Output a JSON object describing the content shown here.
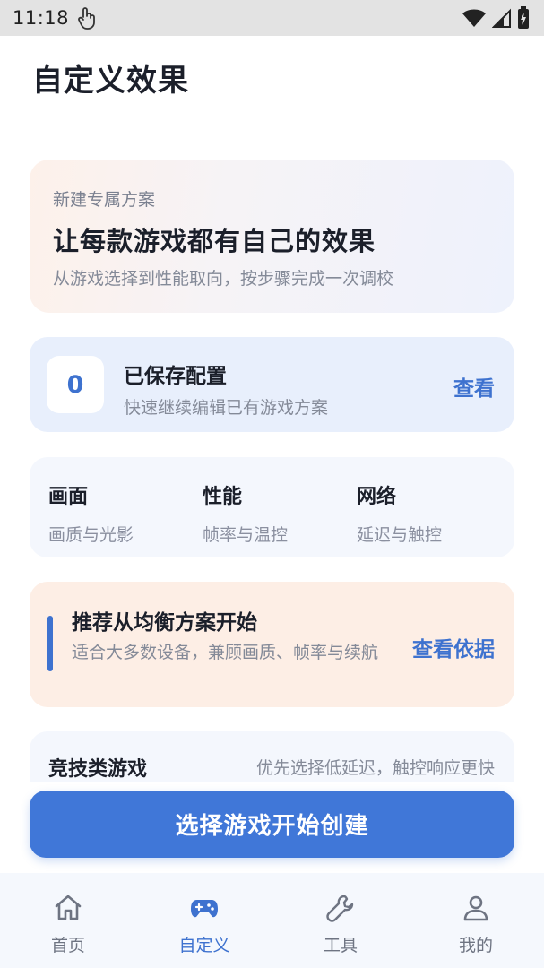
{
  "status_bar": {
    "time": "11:18"
  },
  "page": {
    "title": "自定义效果"
  },
  "hero": {
    "kicker": "新建专属方案",
    "title": "让每款游戏都有自己的效果",
    "subtitle": "从游戏选择到性能取向，按步骤完成一次调校"
  },
  "saved": {
    "count": "0",
    "title": "已保存配置",
    "subtitle": "快速继续编辑已有游戏方案",
    "link": "查看"
  },
  "categories": [
    {
      "title": "画面",
      "subtitle": "画质与光影"
    },
    {
      "title": "性能",
      "subtitle": "帧率与温控"
    },
    {
      "title": "网络",
      "subtitle": "延迟与触控"
    }
  ],
  "recommendation": {
    "title": "推荐从均衡方案开始",
    "description": "适合大多数设备，兼顾画质、帧率与续航",
    "link": "查看依据"
  },
  "preview": {
    "title": "竞技类游戏",
    "description": "优先选择低延迟，触控响应更快"
  },
  "cta": {
    "label": "选择游戏开始创建"
  },
  "bottom_nav": {
    "items": [
      {
        "label": "首页",
        "icon": "home-icon",
        "active": false
      },
      {
        "label": "自定义",
        "icon": "gamepad-icon",
        "active": true
      },
      {
        "label": "工具",
        "icon": "wrench-icon",
        "active": false
      },
      {
        "label": "我的",
        "icon": "person-icon",
        "active": false
      }
    ]
  },
  "colors": {
    "accent": "#4077d8",
    "hero_gradient_start": "#fdf1ea",
    "hero_gradient_end": "#eef2fc",
    "saved_card_bg": "#e8effc",
    "recommendation_bg": "#fdeee5"
  }
}
